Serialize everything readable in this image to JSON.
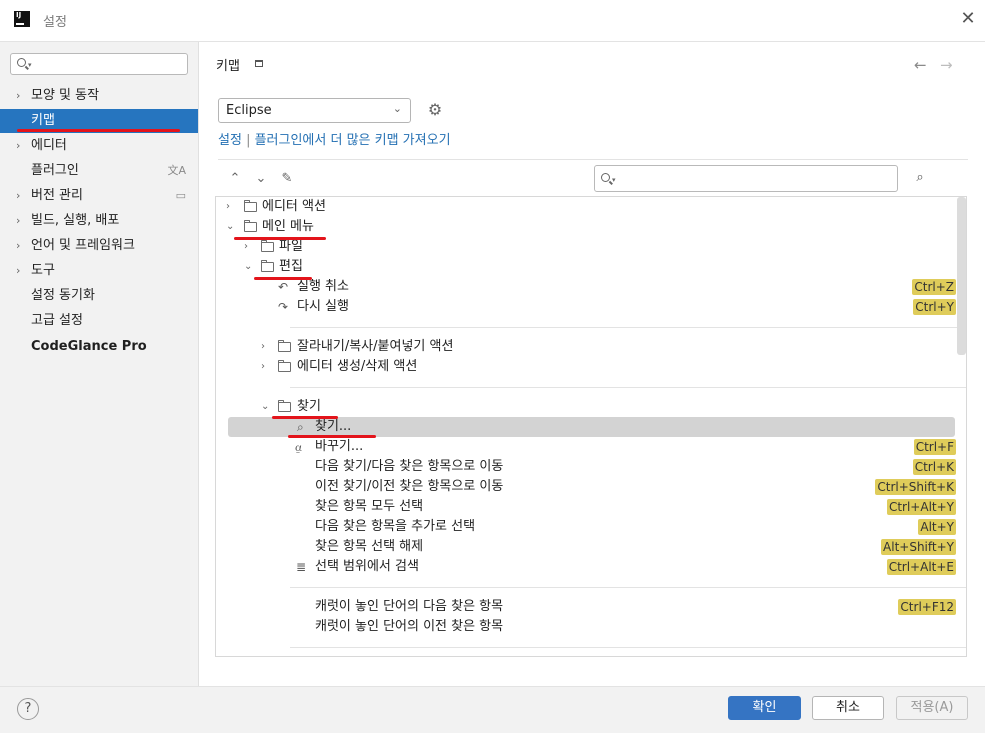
{
  "window": {
    "title": "설정",
    "logo": "IJ"
  },
  "sidebar": {
    "search_placeholder": "",
    "items": [
      {
        "label": "모양 및 동작",
        "expandable": true
      },
      {
        "label": "키맵",
        "expandable": false,
        "selected": true
      },
      {
        "label": "에디터",
        "expandable": true
      },
      {
        "label": "플러그인",
        "expandable": false,
        "icon": "translate-icon"
      },
      {
        "label": "버전 관리",
        "expandable": true,
        "icon": "window-icon"
      },
      {
        "label": "빌드, 실행, 배포",
        "expandable": true
      },
      {
        "label": "언어 및 프레임워크",
        "expandable": true
      },
      {
        "label": "도구",
        "expandable": true
      },
      {
        "label": "설정 동기화",
        "expandable": false
      },
      {
        "label": "고급 설정",
        "expandable": false
      },
      {
        "label": "CodeGlance Pro",
        "expandable": false,
        "bold": true
      }
    ]
  },
  "main": {
    "title": "키맵",
    "keymap_value": "Eclipse",
    "link_prefix": "설정",
    "link_separator": "|",
    "link_text": "플러그인에서 더 많은 키맵 가져오기",
    "tree_search_placeholder": ""
  },
  "tree": [
    {
      "label": "에디터 액션",
      "type": "folder",
      "expanded": false,
      "shortcut": ""
    },
    {
      "label": "메인 메뉴",
      "type": "folder",
      "expanded": true,
      "shortcut": ""
    },
    {
      "label": "파일",
      "type": "folder",
      "expanded": false,
      "shortcut": ""
    },
    {
      "label": "편집",
      "type": "folder",
      "expanded": true,
      "shortcut": ""
    },
    {
      "label": "실행 취소",
      "type": "action",
      "icon": "undo-icon",
      "shortcut": "Ctrl+Z"
    },
    {
      "label": "다시 실행",
      "type": "action",
      "icon": "redo-icon",
      "shortcut": "Ctrl+Y"
    },
    {
      "label": "잘라내기/복사/붙여넣기 액션",
      "type": "folder",
      "expanded": false,
      "shortcut": ""
    },
    {
      "label": "에디터 생성/삭제 액션",
      "type": "folder",
      "expanded": false,
      "shortcut": ""
    },
    {
      "label": "찾기",
      "type": "folder",
      "expanded": true,
      "shortcut": ""
    },
    {
      "label": "찾기...",
      "type": "action",
      "icon": "search-icon",
      "shortcut": "",
      "highlighted": true
    },
    {
      "label": "바꾸기...",
      "type": "action",
      "icon": "replace-icon",
      "shortcut": "Ctrl+F"
    },
    {
      "label": "다음 찾기/다음 찾은 항목으로 이동",
      "type": "action",
      "shortcut": "Ctrl+K"
    },
    {
      "label": "이전 찾기/이전 찾은 항목으로 이동",
      "type": "action",
      "shortcut": "Ctrl+Shift+K"
    },
    {
      "label": "찾은 항목 모두 선택",
      "type": "action",
      "shortcut": "Ctrl+Alt+Y"
    },
    {
      "label": "다음 찾은 항목을 추가로 선택",
      "type": "action",
      "shortcut": "Alt+Y"
    },
    {
      "label": "찾은 항목 선택 해제",
      "type": "action",
      "shortcut": "Alt+Shift+Y"
    },
    {
      "label": "선택 범위에서 검색",
      "type": "action",
      "icon": "search-in-selection-icon",
      "shortcut": "Ctrl+Alt+E"
    },
    {
      "label": "캐럿이 놓인 단어의 다음 찾은 항목",
      "type": "action",
      "shortcut": "Ctrl+F12"
    },
    {
      "label": "캐럿이 놓인 단어의 이전 찾은 항목",
      "type": "action",
      "shortcut": ""
    }
  ],
  "footer": {
    "ok": "확인",
    "cancel": "취소",
    "apply": "적용(A)",
    "help": "?"
  },
  "colors": {
    "accent": "#2675bf",
    "shortcut_bg": "#dfcc5a",
    "annotation": "#e3141b"
  }
}
